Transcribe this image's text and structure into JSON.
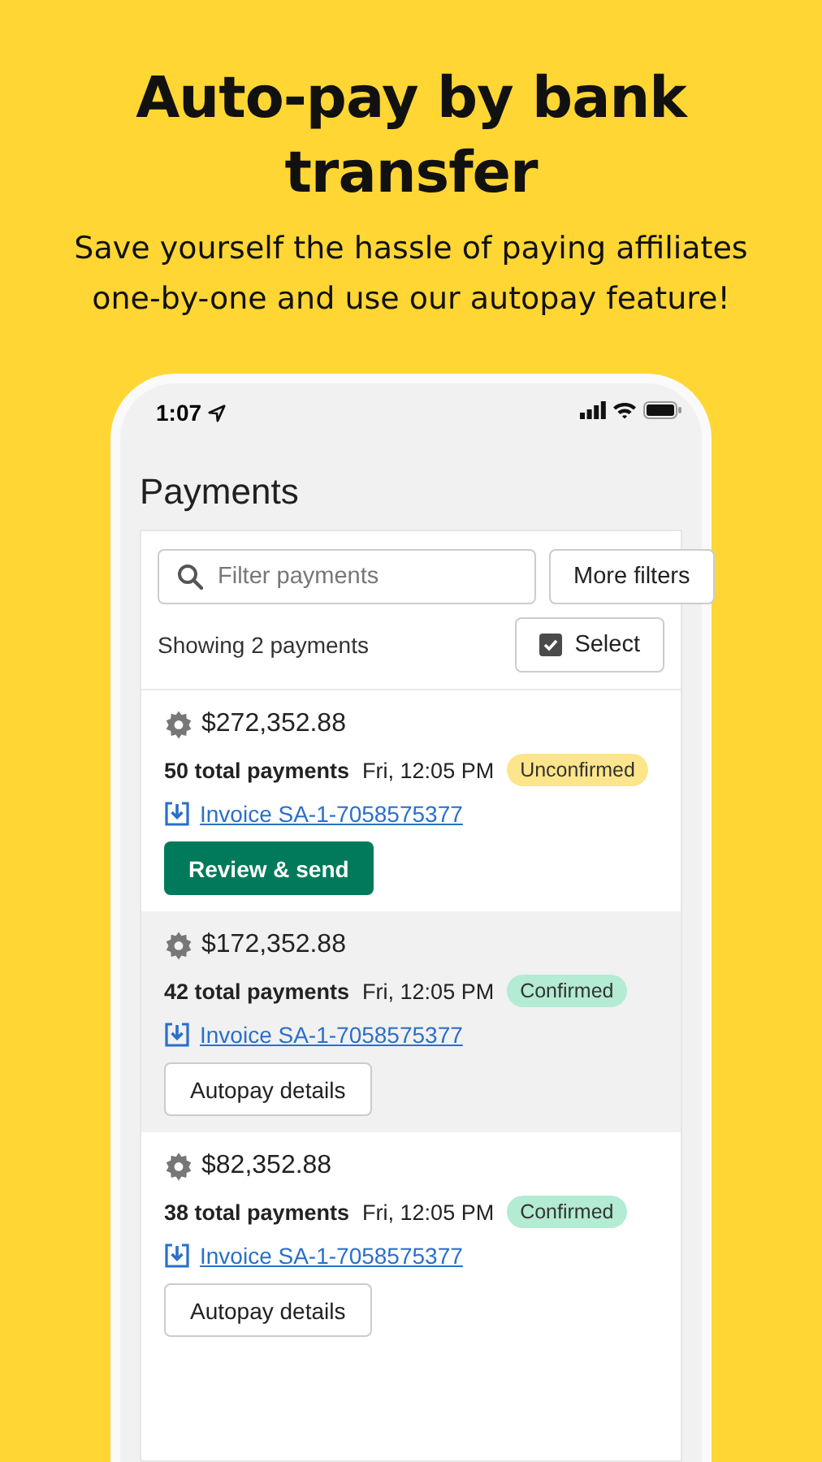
{
  "headline": "Auto-pay by bank transfer",
  "subtitle": "Save yourself the hassle of paying affiliates one-by-one and use our autopay feature!",
  "status_bar": {
    "time": "1:07"
  },
  "page_title": "Payments",
  "search": {
    "placeholder": "Filter payments"
  },
  "filter_button": "More filters",
  "count_text": "Showing 2 payments",
  "select_button": {
    "label": "Select",
    "checked": true
  },
  "payments": [
    {
      "amount": "$272,352.88",
      "total": "50 total payments",
      "time": "Fri, 12:05 PM",
      "status": {
        "kind": "unconfirmed",
        "label": "Unconfirmed"
      },
      "invoice": "Invoice SA-1-7058575377",
      "action": {
        "kind": "primary",
        "label": "Review & send"
      },
      "selected": false
    },
    {
      "amount": "$172,352.88",
      "total": "42 total payments",
      "time": "Fri, 12:05 PM",
      "status": {
        "kind": "confirmed",
        "label": "Confirmed"
      },
      "invoice": "Invoice SA-1-7058575377",
      "action": {
        "kind": "secondary",
        "label": "Autopay details"
      },
      "selected": true
    },
    {
      "amount": "$82,352.88",
      "total": "38 total payments",
      "time": "Fri, 12:05 PM",
      "status": {
        "kind": "confirmed",
        "label": "Confirmed"
      },
      "invoice": "Invoice SA-1-7058575377",
      "action": {
        "kind": "secondary",
        "label": "Autopay details"
      },
      "selected": false
    }
  ]
}
